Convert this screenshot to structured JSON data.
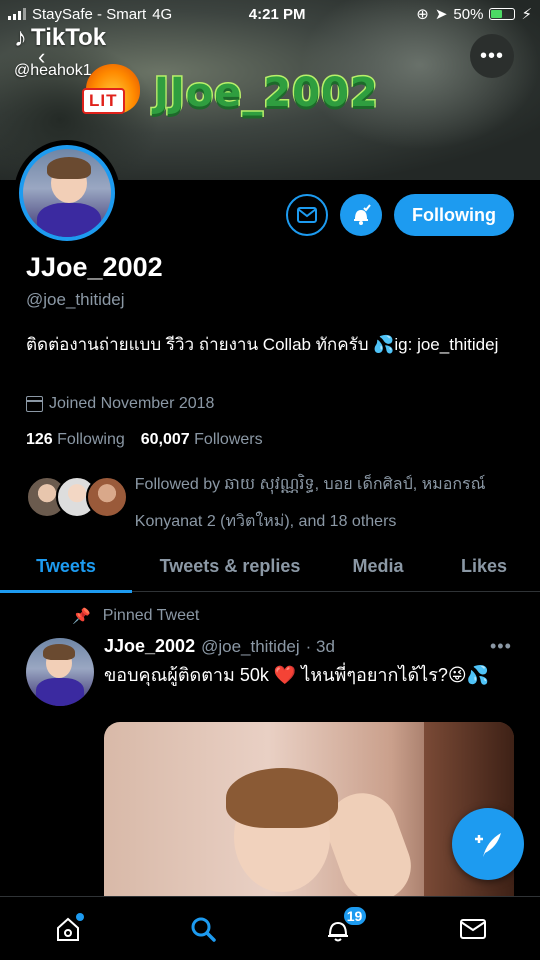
{
  "status_bar": {
    "carrier": "StaySafe - Smart",
    "network": "4G",
    "time": "4:21 PM",
    "battery": "50%"
  },
  "overlay": {
    "app_name": "TikTok",
    "username": "@heahok1",
    "sticker_badge": "LIT",
    "sticker_name": "JJoe_2002"
  },
  "profile": {
    "display_name": "JJoe_2002",
    "handle": "@joe_thitidej",
    "bio": "ติดต่องานถ่ายแบบ รีวิว ถ่ายงาน Collab ทักครับ 💦ig: joe_thitidej",
    "joined": "Joined November 2018",
    "following_count": "126",
    "following_label": "Following",
    "followers_count": "60,007",
    "followers_label": "Followers",
    "followed_by": "Followed by ឆាយ សុវណ្ណរិទ្ធ, บอย เด็กศิลป์, หมอกรณ์ Konyanat 2 (ทวิตใหม่), and 18 others",
    "follow_button": "Following"
  },
  "tabs": [
    "Tweets",
    "Tweets & replies",
    "Media",
    "Likes"
  ],
  "tweet": {
    "pinned_label": "Pinned Tweet",
    "name": "JJoe_2002",
    "handle": "@joe_thitidej",
    "time": "· 3d",
    "text": "ขอบคุณผู้ติดตาม 50k ❤️ ไหนพี่ๆอยากได้ไร?😜💦"
  },
  "nav": {
    "notifications_badge": "19"
  },
  "colors": {
    "accent": "#1d9bf0",
    "muted": "#8b98a5",
    "background": "#000000"
  },
  "icons": [
    "home-icon",
    "search-icon",
    "bell-icon",
    "mail-icon",
    "compose-icon",
    "more-icon",
    "pin-icon",
    "calendar-icon"
  ]
}
